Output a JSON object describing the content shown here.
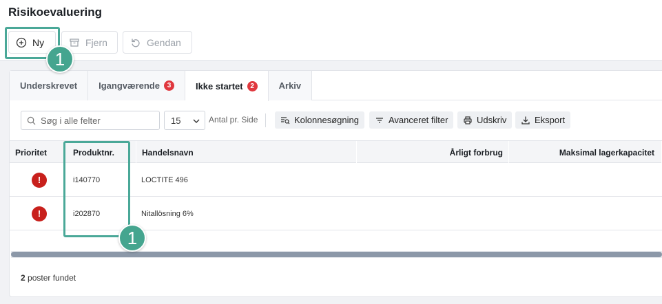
{
  "page": {
    "title": "Risikoevaluering"
  },
  "actions": {
    "new_label": "Ny",
    "remove_label": "Fjern",
    "restore_label": "Gendan"
  },
  "callouts": {
    "first": "1",
    "second": "1"
  },
  "tabs": [
    {
      "label": "Underskrevet",
      "badge": ""
    },
    {
      "label": "Igangværende",
      "badge": "3"
    },
    {
      "label": "Ikke startet",
      "badge": "2"
    },
    {
      "label": "Arkiv",
      "badge": ""
    }
  ],
  "toolbar": {
    "search_placeholder": "Søg i alle felter",
    "page_size": "15",
    "per_page_label": "Antal pr. Side",
    "column_search_label": "Kolonnesøgning",
    "advanced_filter_label": "Avanceret filter",
    "print_label": "Udskriv",
    "export_label": "Eksport"
  },
  "table": {
    "headers": {
      "priority": "Prioritet",
      "product_no": "Produktnr.",
      "trade_name": "Handelsnavn",
      "annual_use": "Årligt forbrug",
      "max_storage": "Maksimal lagerkapacitet"
    },
    "rows": [
      {
        "priority": "!",
        "product_no": "i140770",
        "trade_name": "LOCTITE 496"
      },
      {
        "priority": "!",
        "product_no": "i202870",
        "trade_name": "Nitallösning 6%"
      }
    ]
  },
  "footer": {
    "count": "2",
    "label": " poster fundet"
  },
  "colors": {
    "accent": "#45a58f",
    "priority_high": "#c8201c",
    "badge": "#e0383e"
  }
}
